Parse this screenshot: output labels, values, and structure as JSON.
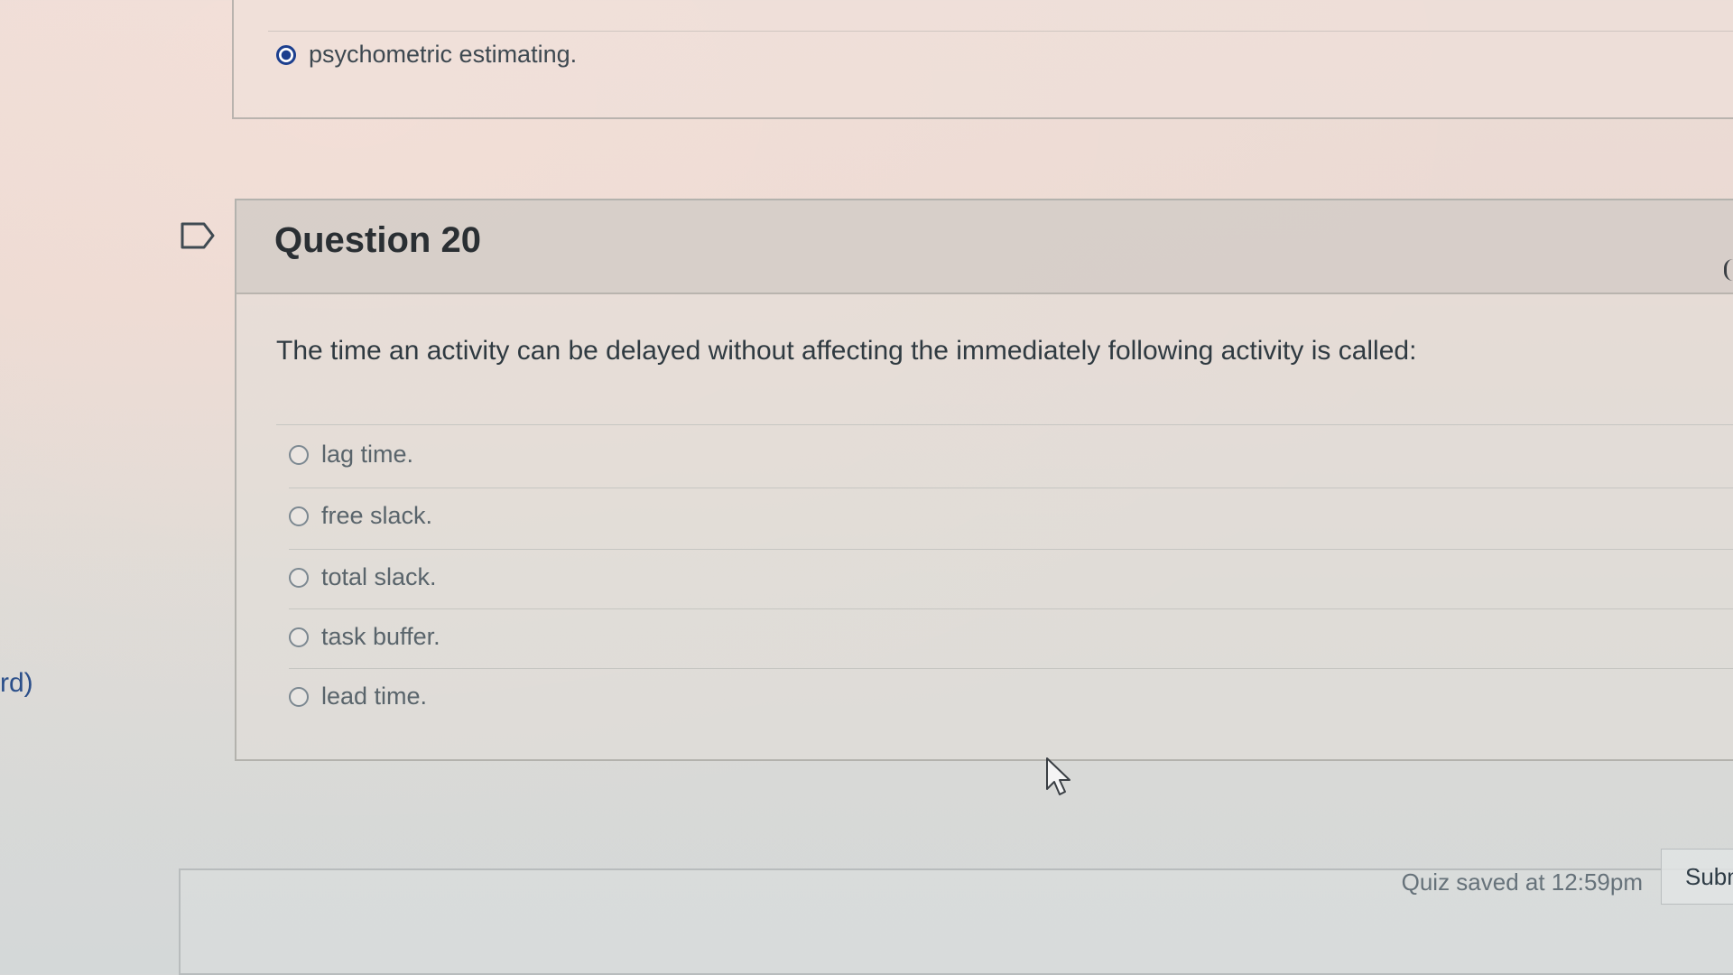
{
  "previous_question": {
    "selected_answer": "psychometric estimating."
  },
  "question": {
    "title": "Question 20",
    "text": "The time an activity can be delayed without affecting the immediately following activity is called:",
    "options": [
      "lag time.",
      "free slack.",
      "total slack.",
      "task buffer.",
      "lead time."
    ]
  },
  "footer": {
    "saved_status": "Quiz saved at 12:59pm",
    "submit_label": "Submit"
  },
  "sidebar": {
    "partial_link": "rd)"
  },
  "colors": {
    "selected_radio": "#1c3f8e",
    "link": "#2b4f8a"
  }
}
